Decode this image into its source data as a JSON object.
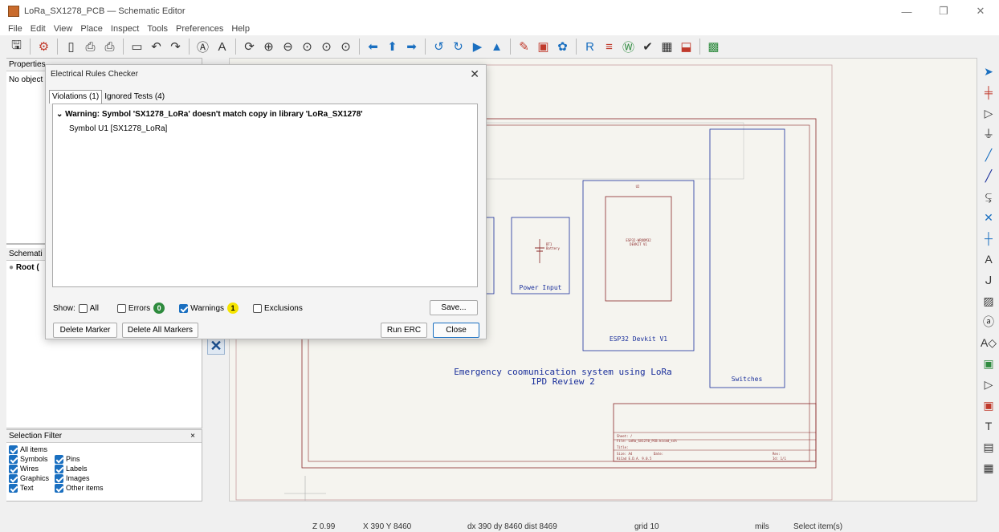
{
  "window": {
    "title": "LoRa_SX1278_PCB — Schematic Editor"
  },
  "menu": [
    "File",
    "Edit",
    "View",
    "Place",
    "Inspect",
    "Tools",
    "Preferences",
    "Help"
  ],
  "left": {
    "properties_title": "Properties",
    "properties_empty": "No object",
    "schematic_title": "Schemati",
    "root_label": "Root (",
    "selection_filter_title": "Selection Filter",
    "filters": [
      {
        "label": "All items",
        "checked": true
      },
      {
        "label": "Symbols",
        "checked": true
      },
      {
        "label": "Pins",
        "checked": true
      },
      {
        "label": "Wires",
        "checked": true
      },
      {
        "label": "Labels",
        "checked": true
      },
      {
        "label": "Graphics",
        "checked": true
      },
      {
        "label": "Images",
        "checked": true
      },
      {
        "label": "Text",
        "checked": true
      },
      {
        "label": "Other items",
        "checked": true
      }
    ]
  },
  "erc": {
    "title": "Electrical Rules Checker",
    "tab_violations": "Violations (1)",
    "tab_ignored": "Ignored Tests (4)",
    "warning": "Warning: Symbol 'SX1278_LoRa' doesn't match copy in library 'LoRa_SX1278'",
    "warning_detail": "Symbol U1 [SX1278_LoRa]",
    "show_label": "Show:",
    "all_label": "All",
    "errors_label": "Errors",
    "errors_count": "0",
    "warnings_label": "Warnings",
    "warnings_count": "1",
    "exclusions_label": "Exclusions",
    "save_label": "Save...",
    "delete_marker": "Delete Marker",
    "delete_all": "Delete All Markers",
    "run_erc": "Run ERC",
    "close": "Close",
    "colors": {
      "errors_badge": "#2e8b3e",
      "warnings_badge": "#f5e400"
    }
  },
  "schematic": {
    "power_input": "Power Input",
    "esp32_block": "ESP32 Devkit V1",
    "switches_block": "Switches",
    "title_line1": "Emergency coomunication system using LoRa",
    "title_line2": "IPD Review 2",
    "sheet": "Sheet: /",
    "file": "File: LoRa_SX1278_PCB.kicad_sch",
    "title_field": "Title:",
    "size": "Size: A4",
    "date": "Date:",
    "rev": "Rev:",
    "kicad": "KiCad E.D.A. 9.0.5",
    "id": "Id: 1/1",
    "u2": "U2",
    "esp_part": "ESP32-WROOM32",
    "esp_part2": "DEVKIT V1",
    "bt1": "BT1",
    "battery": "Battery"
  },
  "status": {
    "zoom": "Z 0.99",
    "xy": "X 390  Y 8460",
    "delta": "dx 390  dy 8460  dist 8469",
    "grid": "grid 10",
    "units": "mils",
    "mode": "Select item(s)"
  }
}
